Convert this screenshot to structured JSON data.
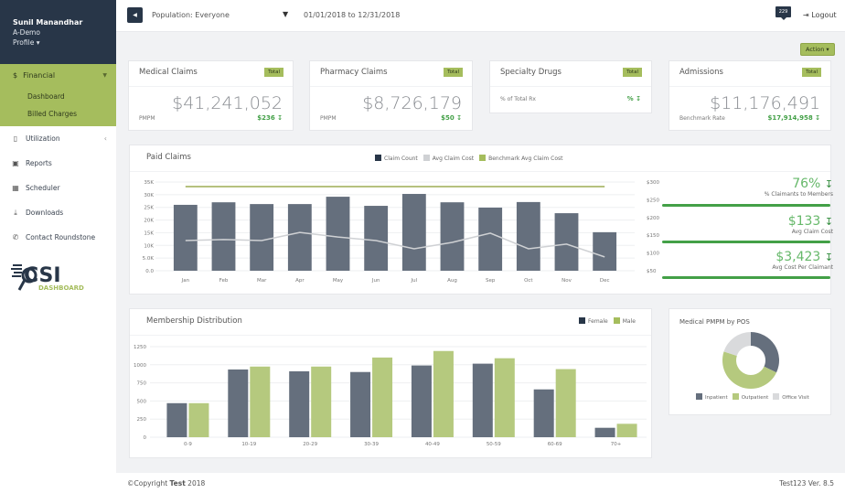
{
  "user": {
    "name": "Sunil Manandhar",
    "org": "A-Demo",
    "profile_label": "Profile ▾"
  },
  "sidebar": {
    "financial": {
      "label": "Financial",
      "icon": "$",
      "sub": [
        "Dashboard",
        "Billed Charges"
      ]
    },
    "items": [
      {
        "label": "Utilization",
        "icon": "tablet-icon",
        "glyph": "▯",
        "chevron": "‹"
      },
      {
        "label": "Reports",
        "icon": "report-icon",
        "glyph": "▣"
      },
      {
        "label": "Scheduler",
        "icon": "calendar-icon",
        "glyph": "▦"
      },
      {
        "label": "Downloads",
        "icon": "download-icon",
        "glyph": "⤓"
      },
      {
        "label": "Contact Roundstone",
        "icon": "phone-icon",
        "glyph": "✆"
      }
    ],
    "logo": {
      "main": "CSI",
      "sub": "DASHBOARD"
    }
  },
  "topbar": {
    "back_glyph": "◀",
    "population": "Population: Everyone",
    "filter_glyph": "▼",
    "date_range": "01/01/2018 to 12/31/2018",
    "notifications": "229",
    "logout": "Logout",
    "logout_glyph": "⇥"
  },
  "action_label": "Action ▾",
  "kpis": [
    {
      "title": "Medical Claims",
      "badge": "Total",
      "value": "$41,241,052",
      "label": "PMPM",
      "sub": "$236 ↧"
    },
    {
      "title": "Pharmacy Claims",
      "badge": "Total",
      "value": "$8,726,179",
      "label": "PMPM",
      "sub": "$50 ↧"
    },
    {
      "title": "Specialty Drugs",
      "badge": "Total",
      "value": "",
      "label": "% of Total Rx",
      "sub": "% ↧"
    },
    {
      "title": "Admissions",
      "badge": "Total",
      "value": "$11,176,491",
      "label": "Benchmark Rate",
      "sub": "$17,914,958 ↧"
    }
  ],
  "stats": [
    {
      "value": "76%",
      "arrow": "↧",
      "label": "% Claimants to Members"
    },
    {
      "value": "$133",
      "arrow": "↧",
      "label": "Avg Claim Cost"
    },
    {
      "value": "$3,423",
      "arrow": "↧",
      "label": "Avg Cost Per Claimant"
    }
  ],
  "colors": {
    "navy": "#283648",
    "green": "#a5bd5d",
    "bar": "#656f7d",
    "line": "#cfd1d4",
    "bench": "#b5c17e",
    "good": "#43a047"
  },
  "chart_data": [
    {
      "type": "bar",
      "title": "Paid Claims",
      "categories": [
        "Jan",
        "Feb",
        "Mar",
        "Apr",
        "May",
        "Jun",
        "Jul",
        "Aug",
        "Sep",
        "Oct",
        "Nov",
        "Dec"
      ],
      "series": [
        {
          "name": "Claim Count",
          "type": "bar",
          "axis": "left",
          "values": [
            26000,
            27000,
            26300,
            26300,
            29200,
            25600,
            30300,
            27000,
            24900,
            27100,
            22700,
            15200
          ]
        },
        {
          "name": "Avg Claim Cost",
          "type": "line",
          "axis": "right",
          "values": [
            135,
            138,
            135,
            158,
            145,
            135,
            112,
            130,
            156,
            112,
            125,
            89
          ]
        },
        {
          "name": "Benchmark Avg Claim Cost",
          "type": "line",
          "axis": "right",
          "values": [
            287,
            287,
            287,
            287,
            287,
            287,
            287,
            287,
            287,
            287,
            287,
            287
          ]
        }
      ],
      "y_left": {
        "ticks": [
          "0.0",
          "5.0K",
          "10K",
          "15K",
          "20K",
          "25K",
          "30K",
          "35K"
        ],
        "range": [
          0,
          35000
        ]
      },
      "y_right": {
        "ticks": [
          "$50",
          "$100",
          "$150",
          "$200",
          "$250",
          "$300"
        ],
        "range": [
          50,
          300
        ]
      },
      "legend": "top-right",
      "grid": true
    },
    {
      "type": "bar",
      "title": "Membership Distribution",
      "categories": [
        "0-9",
        "10-19",
        "20-29",
        "30-39",
        "40-49",
        "50-59",
        "60-69",
        "70+"
      ],
      "series": [
        {
          "name": "Female",
          "values": [
            470,
            935,
            910,
            900,
            990,
            1015,
            660,
            130
          ]
        },
        {
          "name": "Male",
          "values": [
            470,
            975,
            975,
            1100,
            1190,
            1090,
            940,
            185
          ]
        }
      ],
      "y_ticks": [
        "0",
        "250",
        "500",
        "750",
        "1000",
        "1250"
      ],
      "ylim": [
        0,
        1250
      ],
      "legend": "top-right",
      "grid": true
    },
    {
      "type": "pie",
      "title": "Medical PMPM by POS",
      "categories": [
        "Inpatient",
        "Outpatient",
        "Office Visit"
      ],
      "values": [
        32,
        48,
        20
      ],
      "donut": true,
      "legend": "bottom"
    }
  ],
  "footer": {
    "copyright": "©Copyright ",
    "company": "Test",
    "year": " 2018",
    "version": "Test123 Ver. 8.5"
  }
}
